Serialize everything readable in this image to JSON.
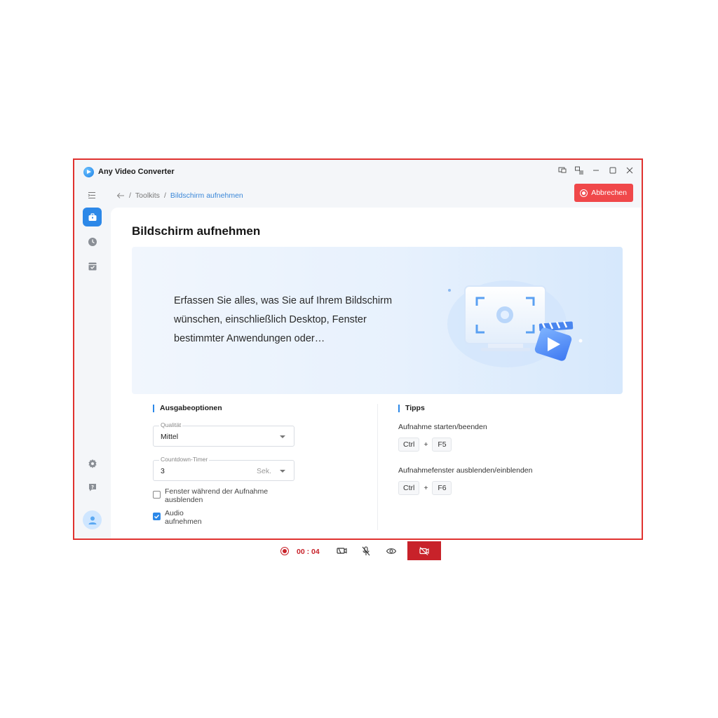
{
  "app": {
    "title": "Any Video Converter"
  },
  "breadcrumb": {
    "parent": "Toolkits",
    "separator": "/",
    "current": "Bildschirm aufnehmen"
  },
  "toolbar": {
    "abort_label": "Abbrechen"
  },
  "page": {
    "title": "Bildschirm aufnehmen",
    "banner_text": "Erfassen Sie alles, was Sie auf Ihrem Bildschirm wünschen, einschließlich Desktop, Fenster bestimmter Anwendungen oder…"
  },
  "output_options": {
    "heading": "Ausgabeoptionen",
    "quality": {
      "label": "Qualität",
      "value": "Mittel"
    },
    "countdown": {
      "label": "Countdown-Timer",
      "value": "3",
      "unit": "Sek."
    },
    "hide_window": {
      "label": "Fenster während der Aufnahme ausblenden",
      "checked": false
    },
    "record_audio": {
      "label": "Audio aufnehmen",
      "checked": true
    }
  },
  "tips": {
    "heading": "Tipps",
    "items": [
      {
        "label": "Aufnahme starten/beenden",
        "keys": [
          "Ctrl",
          "F5"
        ]
      },
      {
        "label": "Aufnahmefenster ausblenden/einblenden",
        "keys": [
          "Ctrl",
          "F6"
        ]
      }
    ],
    "plus": "+"
  },
  "recording_bar": {
    "time": "00 : 04"
  },
  "colors": {
    "accent": "#2c88e8",
    "danger": "#f0484a",
    "record_red": "#c8222a",
    "frame": "#e0322f"
  },
  "icons": {
    "window": [
      "feedback-icon",
      "menu-icon",
      "minimize-icon",
      "maximize-icon",
      "close-icon"
    ],
    "sidebar": [
      "toolbox-icon",
      "history-icon",
      "tasks-icon",
      "settings-icon",
      "help-icon",
      "user-icon"
    ],
    "recording": [
      "record-icon",
      "webcam-icon",
      "mic-off-icon",
      "eye-icon",
      "camera-off-icon"
    ]
  }
}
